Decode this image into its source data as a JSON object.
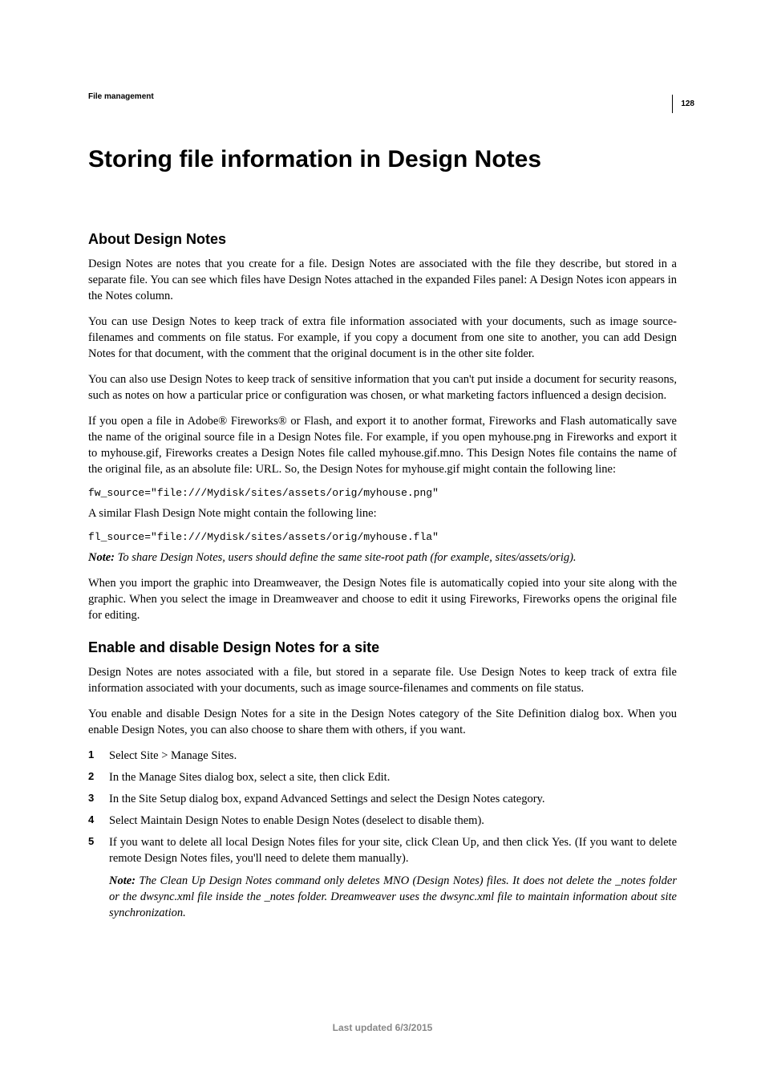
{
  "page_number": "128",
  "header": "File management",
  "title": "Storing file information in Design Notes",
  "section1": {
    "heading": "About Design Notes",
    "p1": "Design Notes are notes that you create for a file. Design Notes are associated with the file they describe, but stored in a separate file. You can see which files have Design Notes attached in the expanded Files panel: A Design Notes icon appears in the Notes column.",
    "p2": "You can use Design Notes to keep track of extra file information associated with your documents, such as image source-filenames and comments on file status. For example, if you copy a document from one site to another, you can add Design Notes for that document, with the comment that the original document is in the other site folder.",
    "p3": "You can also use Design Notes to keep track of sensitive information that you can't put inside a document for security reasons, such as notes on how a particular price or configuration was chosen, or what marketing factors influenced a design decision.",
    "p4": "If you open a file in Adobe® Fireworks® or Flash, and export it to another format, Fireworks and Flash automatically save the name of the original source file in a Design Notes file. For example, if you open myhouse.png in Fireworks and export it to myhouse.gif, Fireworks creates a Design Notes file called myhouse.gif.mno. This Design Notes file contains the name of the original file, as an absolute file: URL. So, the Design Notes for myhouse.gif might contain the following line:",
    "code1": "fw_source=\"file:///Mydisk/sites/assets/orig/myhouse.png\"",
    "p5": "A similar Flash Design Note might contain the following line:",
    "code2": "fl_source=\"file:///Mydisk/sites/assets/orig/myhouse.fla\"",
    "note_label": "Note:",
    "note1": " To share Design Notes, users should define the same site-root path (for example, sites/assets/orig).",
    "p6": "When you import the graphic into Dreamweaver, the Design Notes file is automatically copied into your site along with the graphic. When you select the image in Dreamweaver and choose to edit it using Fireworks, Fireworks opens the original file for editing."
  },
  "section2": {
    "heading": "Enable and disable Design Notes for a site",
    "p1": "Design Notes are notes associated with a file, but stored in a separate file. Use Design Notes to keep track of extra file information associated with your documents, such as image source-filenames and comments on file status.",
    "p2": "You enable and disable Design Notes for a site in the Design Notes category of the Site Definition dialog box. When you enable Design Notes, you can also choose to share them with others, if you want.",
    "steps": [
      "Select Site > Manage Sites.",
      "In the Manage Sites dialog box, select a site, then click Edit.",
      "In the Site Setup dialog box, expand Advanced Settings and select the Design Notes category.",
      "Select Maintain Design Notes to enable Design Notes (deselect to disable them).",
      "If you want to delete all local Design Notes files for your site, click Clean Up, and then click Yes. (If you want to delete remote Design Notes files, you'll need to delete them manually)."
    ],
    "note_label": "Note:",
    "step_note": " The Clean Up Design Notes command only deletes MNO (Design Notes) files. It does not delete the _notes folder or the dwsync.xml file inside the _notes folder. Dreamweaver uses the dwsync.xml file to maintain information about site synchronization."
  },
  "footer": "Last updated 6/3/2015"
}
